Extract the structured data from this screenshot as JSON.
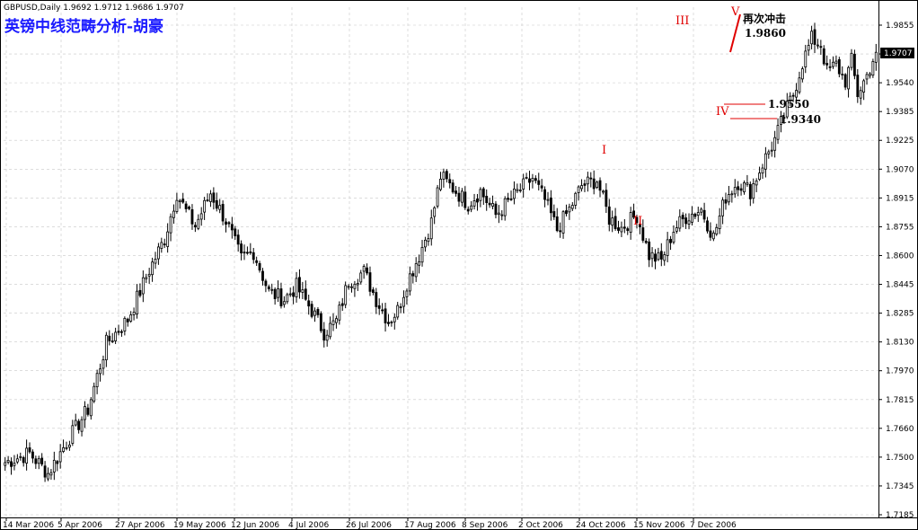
{
  "header": {
    "symbol_info": "GBPUSD,Daily  1.9692 1.9712 1.9686 1.9707",
    "title": "英镑中线范畴分析-胡豪"
  },
  "current_price": "1.9707",
  "colors": {
    "bull": "#000000",
    "bear_fill": "#000000",
    "grid": "#c8c8c8",
    "annotation": "#e00000",
    "title": "#1a1aff"
  },
  "chart_data": {
    "type": "candlestick",
    "x_tick_labels": [
      "14 Mar 2006",
      "5 Apr 2006",
      "27 Apr 2006",
      "19 May 2006",
      "12 Jun 2006",
      "4 Jul 2006",
      "26 Jul 2006",
      "17 Aug 2006",
      "8 Sep 2006",
      "2 Oct 2006",
      "24 Oct 2006",
      "15 Nov 2006",
      "7 Dec 2006"
    ],
    "y_tick_labels": [
      "1.9855",
      "1.9700",
      "1.9540",
      "1.9385",
      "1.9225",
      "1.9070",
      "1.8915",
      "1.8755",
      "1.8600",
      "1.8445",
      "1.8285",
      "1.8130",
      "1.7970",
      "1.7815",
      "1.7660",
      "1.7500",
      "1.7345",
      "1.7185"
    ],
    "ylim": [
      1.7185,
      1.9855
    ],
    "grid": true,
    "path": [
      [
        0,
        1.747
      ],
      [
        8,
        1.752
      ],
      [
        14,
        1.741
      ],
      [
        20,
        1.758
      ],
      [
        27,
        1.776
      ],
      [
        33,
        1.812
      ],
      [
        40,
        1.825
      ],
      [
        47,
        1.852
      ],
      [
        52,
        1.869
      ],
      [
        56,
        1.894
      ],
      [
        59,
        1.884
      ],
      [
        62,
        1.876
      ],
      [
        67,
        1.894
      ],
      [
        72,
        1.879
      ],
      [
        77,
        1.858
      ],
      [
        81,
        1.862
      ],
      [
        86,
        1.84
      ],
      [
        91,
        1.836
      ],
      [
        95,
        1.843
      ],
      [
        100,
        1.83
      ],
      [
        104,
        1.818
      ],
      [
        108,
        1.824
      ],
      [
        112,
        1.846
      ],
      [
        117,
        1.851
      ],
      [
        121,
        1.836
      ],
      [
        125,
        1.824
      ],
      [
        128,
        1.83
      ],
      [
        131,
        1.845
      ],
      [
        135,
        1.86
      ],
      [
        139,
        1.878
      ],
      [
        142,
        1.903
      ],
      [
        147,
        1.895
      ],
      [
        151,
        1.888
      ],
      [
        155,
        1.895
      ],
      [
        160,
        1.882
      ],
      [
        164,
        1.889
      ],
      [
        168,
        1.896
      ],
      [
        172,
        1.902
      ],
      [
        176,
        1.89
      ],
      [
        180,
        1.874
      ],
      [
        184,
        1.885
      ],
      [
        188,
        1.898
      ],
      [
        193,
        1.901
      ],
      [
        197,
        1.88
      ],
      [
        201,
        1.875
      ],
      [
        206,
        1.882
      ],
      [
        210,
        1.86
      ],
      [
        214,
        1.857
      ],
      [
        218,
        1.874
      ],
      [
        222,
        1.881
      ],
      [
        227,
        1.885
      ],
      [
        231,
        1.87
      ],
      [
        235,
        1.892
      ],
      [
        239,
        1.9
      ],
      [
        243,
        1.895
      ],
      [
        247,
        1.91
      ],
      [
        251,
        1.923
      ],
      [
        254,
        1.936
      ],
      [
        257,
        1.948
      ],
      [
        260,
        1.965
      ],
      [
        263,
        1.978
      ],
      [
        266,
        1.975
      ],
      [
        268,
        1.96
      ],
      [
        271,
        1.964
      ],
      [
        274,
        1.955
      ],
      [
        276,
        1.966
      ],
      [
        278,
        1.948
      ],
      [
        281,
        1.958
      ],
      [
        284,
        1.971
      ]
    ],
    "annotations": {
      "waves": [
        "I",
        "II",
        "III",
        "IV",
        "V"
      ],
      "note": "再次冲击",
      "targets": [
        "1.9860",
        "1.9550",
        "1.9340"
      ]
    }
  }
}
